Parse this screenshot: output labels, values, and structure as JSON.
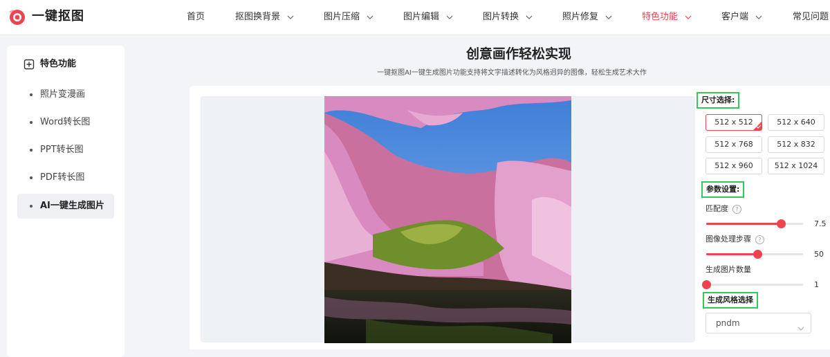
{
  "brand": {
    "name": "一键抠图"
  },
  "nav": {
    "items": [
      {
        "label": "首页",
        "has_dropdown": false,
        "active": false
      },
      {
        "label": "抠图换背景",
        "has_dropdown": true,
        "active": false
      },
      {
        "label": "图片压缩",
        "has_dropdown": true,
        "active": false
      },
      {
        "label": "图片编辑",
        "has_dropdown": true,
        "active": false
      },
      {
        "label": "图片转换",
        "has_dropdown": true,
        "active": false
      },
      {
        "label": "照片修复",
        "has_dropdown": true,
        "active": false
      },
      {
        "label": "特色功能",
        "has_dropdown": true,
        "active": true
      },
      {
        "label": "客户端",
        "has_dropdown": true,
        "active": false
      },
      {
        "label": "常见问题",
        "has_dropdown": false,
        "active": false
      }
    ]
  },
  "sidebar": {
    "heading": "特色功能",
    "items": [
      {
        "label": "照片变漫画",
        "active": false
      },
      {
        "label": "Word转长图",
        "active": false
      },
      {
        "label": "PPT转长图",
        "active": false
      },
      {
        "label": "PDF转长图",
        "active": false
      },
      {
        "label": "AI一键生成图片",
        "active": true
      }
    ]
  },
  "header": {
    "title": "创意画作轻松实现",
    "subtitle": "一键抠图AI一键生成图片功能支持将文字描述转化为风格迥异的图像，轻松生成艺术大作"
  },
  "controls": {
    "size_heading": "尺寸选择:",
    "sizes": [
      "512 x 512",
      "512 x 640",
      "512 x 768",
      "512 x 832",
      "512 x 960",
      "512 x 1024"
    ],
    "selected_size": "512 x 512",
    "params_heading": "参数设置:",
    "params": [
      {
        "label": "匹配度",
        "help": true,
        "value": "7.5",
        "fraction": 0.77
      },
      {
        "label": "图像处理步骤",
        "help": true,
        "value": "50",
        "fraction": 0.53
      },
      {
        "label": "生成图片数量",
        "help": false,
        "value": "1",
        "fraction": 0.0
      }
    ],
    "style_heading": "生成风格选择",
    "style_value": "pndm"
  },
  "colors": {
    "accent": "#f0434f",
    "highlight_box": "#34c759",
    "sky": "#4a86d6",
    "blossom": "#d98ac0",
    "moss": "#6f8f2c",
    "water": "#1a1f14"
  }
}
